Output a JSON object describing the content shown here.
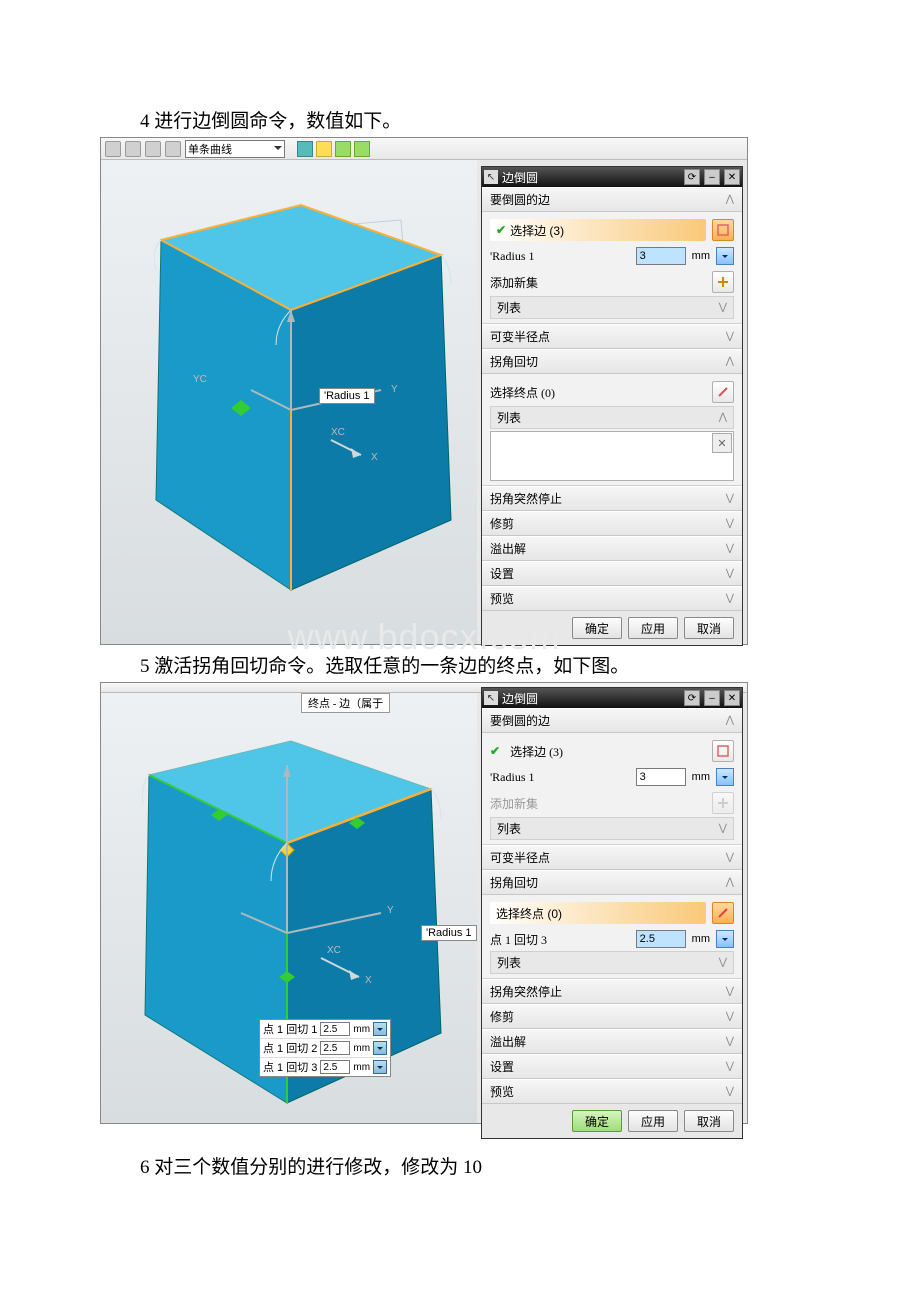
{
  "steps": {
    "s4": "4 进行边倒圆命令，数值如下。",
    "s5": "5 激活拐角回切命令。选取任意的一条边的终点，如下图。",
    "s6": "6 对三个数值分别的进行修改，修改为 10"
  },
  "watermark": "www.bdocx.com",
  "toolbar": {
    "combo_label": "单条曲线"
  },
  "viewport": {
    "radius_label": "'Radius 1",
    "xc": "XC",
    "yc": "YC",
    "y": "Y",
    "x": "X",
    "top_prompt": "终点 - 边（属于"
  },
  "dialog1": {
    "title": "边倒圆",
    "sec_edges": "要倒圆的边",
    "select_edge": "选择边 (3)",
    "radius_label": "'Radius 1",
    "radius_value": "3",
    "unit_mm": "mm",
    "add_set": "添加新集",
    "list": "列表",
    "var_radius": "可变半径点",
    "corner": "拐角回切",
    "select_endpoint": "选择终点 (0)",
    "corner_stop": "拐角突然停止",
    "trim": "修剪",
    "overflow": "溢出解",
    "settings": "设置",
    "preview": "预览",
    "ok": "确定",
    "apply": "应用",
    "cancel": "取消"
  },
  "dialog2": {
    "title": "边倒圆",
    "sec_edges": "要倒圆的边",
    "select_edge": "选择边 (3)",
    "radius_label": "'Radius 1",
    "radius_value": "3",
    "unit_mm": "mm",
    "add_set": "添加新集",
    "list": "列表",
    "var_radius": "可变半径点",
    "corner": "拐角回切",
    "select_endpoint": "选择终点 (0)",
    "setback_label": "点 1 回切 3",
    "setback_value": "2.5",
    "corner_stop": "拐角突然停止",
    "trim": "修剪",
    "overflow": "溢出解",
    "settings": "设置",
    "preview": "预览",
    "ok": "确定",
    "apply": "应用",
    "cancel": "取消"
  },
  "mini": {
    "row1_label": "点 1 回切 1",
    "row2_label": "点 1 回切 2",
    "row3_label": "点 1 回切 3",
    "value": "2.5",
    "unit": "mm"
  }
}
